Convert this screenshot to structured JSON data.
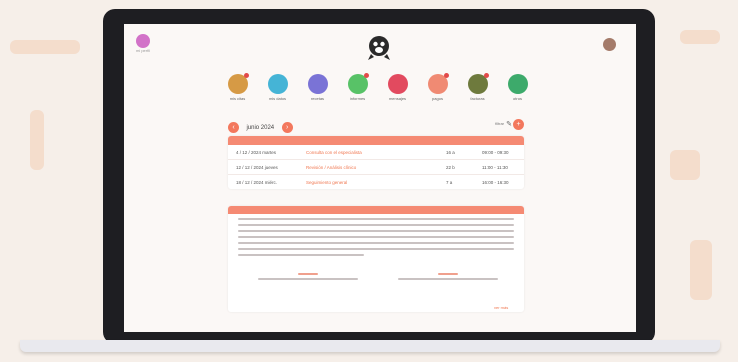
{
  "header": {
    "user_label": "mi perfil"
  },
  "nav": [
    {
      "label": "mis citas",
      "color": "#d69a45",
      "badge": true
    },
    {
      "label": "mis datos",
      "color": "#45b4d6",
      "badge": false
    },
    {
      "label": "recetas",
      "color": "#7a73d6",
      "badge": false
    },
    {
      "label": "informes",
      "color": "#58c267",
      "badge": true
    },
    {
      "label": "mensajes",
      "color": "#e24a5f",
      "badge": false
    },
    {
      "label": "pagos",
      "color": "#f08a73",
      "badge": true
    },
    {
      "label": "facturas",
      "color": "#6e7a3d",
      "badge": true
    },
    {
      "label": "otros",
      "color": "#3daa6b",
      "badge": false
    }
  ],
  "month_bar": {
    "prev": "‹",
    "label": "junio 2024",
    "next": "›",
    "filter_label": "filtrar",
    "add": "+"
  },
  "table": {
    "rows": [
      {
        "date": "4 / 12 / 2024 martes",
        "title": "Consulta con el especialista",
        "code": "16 a",
        "time": "09:00 - 09:30"
      },
      {
        "date": "12 / 12 / 2024 jueves",
        "title": "Revisión / Análisis clínico",
        "code": "22 b",
        "time": "11:00 - 11:30"
      },
      {
        "date": "18 / 12 / 2024 miérc.",
        "title": "Seguimiento general",
        "code": "7 a",
        "time": "16:00 - 16:30"
      }
    ]
  },
  "footer": {
    "more_label": "ver más"
  },
  "colors": {
    "accent": "#f58a73",
    "link": "#f0764f"
  }
}
